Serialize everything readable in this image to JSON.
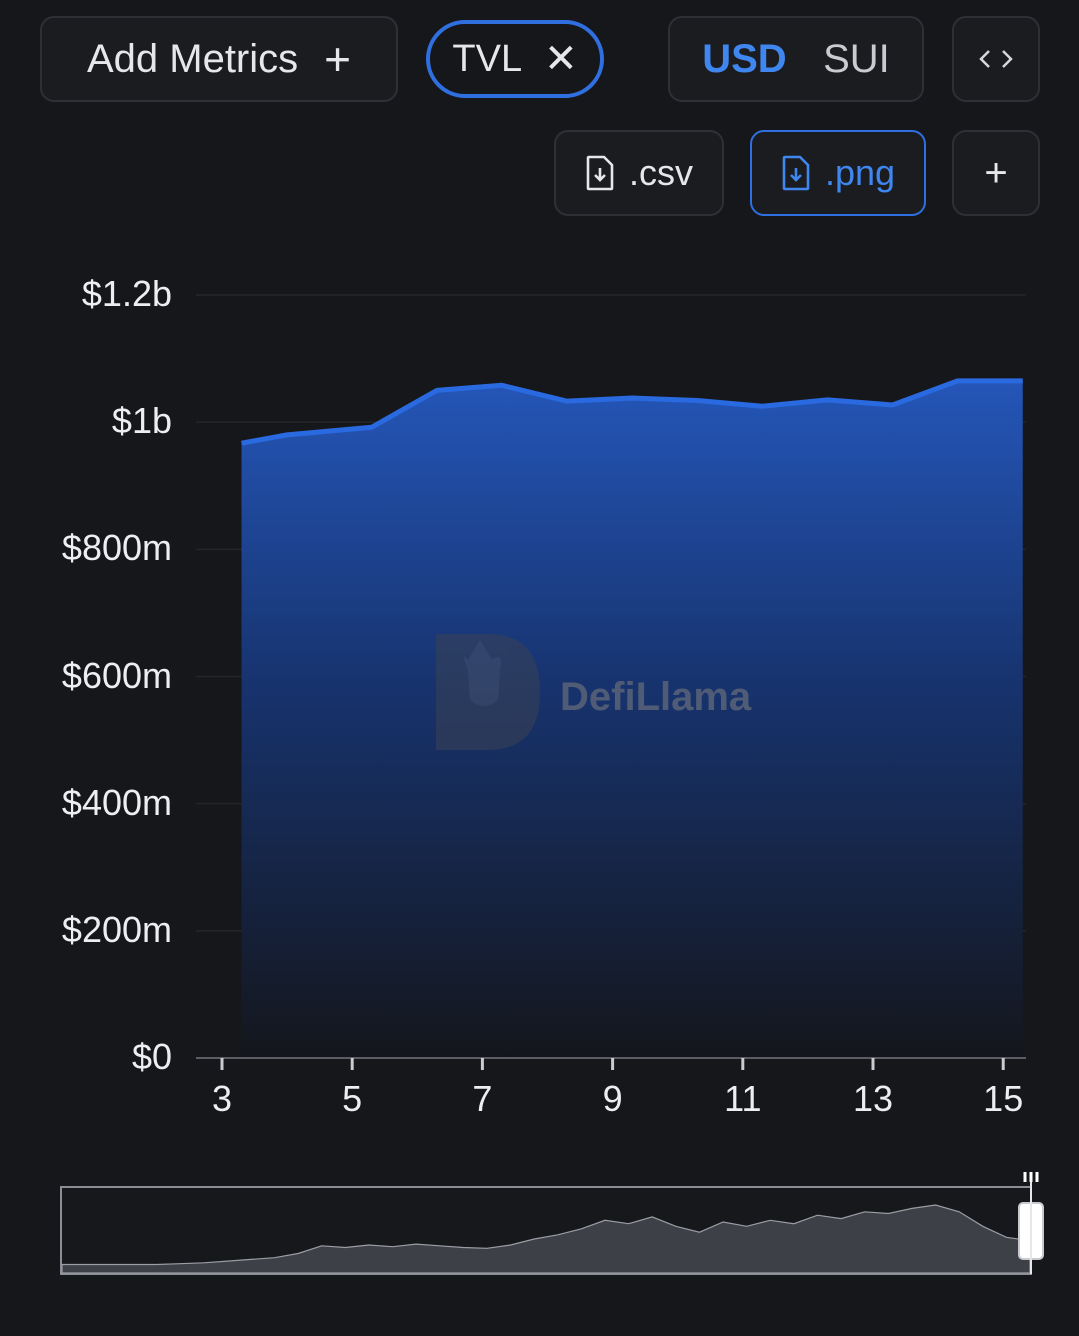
{
  "toolbar": {
    "add_metrics_label": "Add Metrics",
    "add_metrics_icon": "+",
    "metric_chip_label": "TVL",
    "metric_chip_close": "✕",
    "currency_options": [
      "USD",
      "SUI"
    ],
    "currency_selected": "USD",
    "embed_icon": "<>",
    "csv_label": ".csv",
    "png_label": ".png",
    "add_icon": "+"
  },
  "watermark": "DefiLlama",
  "colors": {
    "background": "#16171b",
    "accent": "#2f6fe0",
    "line": "#2a6ae0",
    "brush_area": "#3e4048"
  },
  "chart_data": {
    "type": "area",
    "title": "",
    "xlabel": "",
    "ylabel": "",
    "x": [
      3.3,
      4.0,
      5.3,
      6.3,
      7.3,
      8.3,
      9.3,
      10.3,
      11.3,
      12.3,
      13.3,
      14.3,
      15.3
    ],
    "values": [
      967,
      980,
      992,
      1050,
      1058,
      1033,
      1038,
      1034,
      1025,
      1035,
      1027,
      1065,
      1065
    ],
    "x_ticks": [
      "3",
      "5",
      "7",
      "9",
      "11",
      "13",
      "15"
    ],
    "x_tick_values": [
      3,
      5,
      7,
      9,
      11,
      13,
      15
    ],
    "y_ticks": [
      "$0",
      "$200m",
      "$400m",
      "$600m",
      "$800m",
      "$1b",
      "$1.2b"
    ],
    "y_tick_values": [
      0,
      200,
      400,
      600,
      800,
      1000,
      1200
    ],
    "ylim": [
      0,
      1200
    ],
    "xlim": [
      3,
      15.35
    ],
    "y_unit": "millions USD",
    "grid": true,
    "legend": "none",
    "brush_overview": {
      "values": [
        0.1,
        0.1,
        0.1,
        0.1,
        0.1,
        0.11,
        0.12,
        0.14,
        0.16,
        0.18,
        0.23,
        0.32,
        0.3,
        0.33,
        0.31,
        0.34,
        0.32,
        0.3,
        0.29,
        0.33,
        0.4,
        0.45,
        0.52,
        0.62,
        0.58,
        0.66,
        0.55,
        0.48,
        0.6,
        0.55,
        0.62,
        0.58,
        0.68,
        0.64,
        0.72,
        0.7,
        0.76,
        0.8,
        0.72,
        0.55,
        0.42,
        0.38
      ],
      "selected_range": "end"
    }
  }
}
